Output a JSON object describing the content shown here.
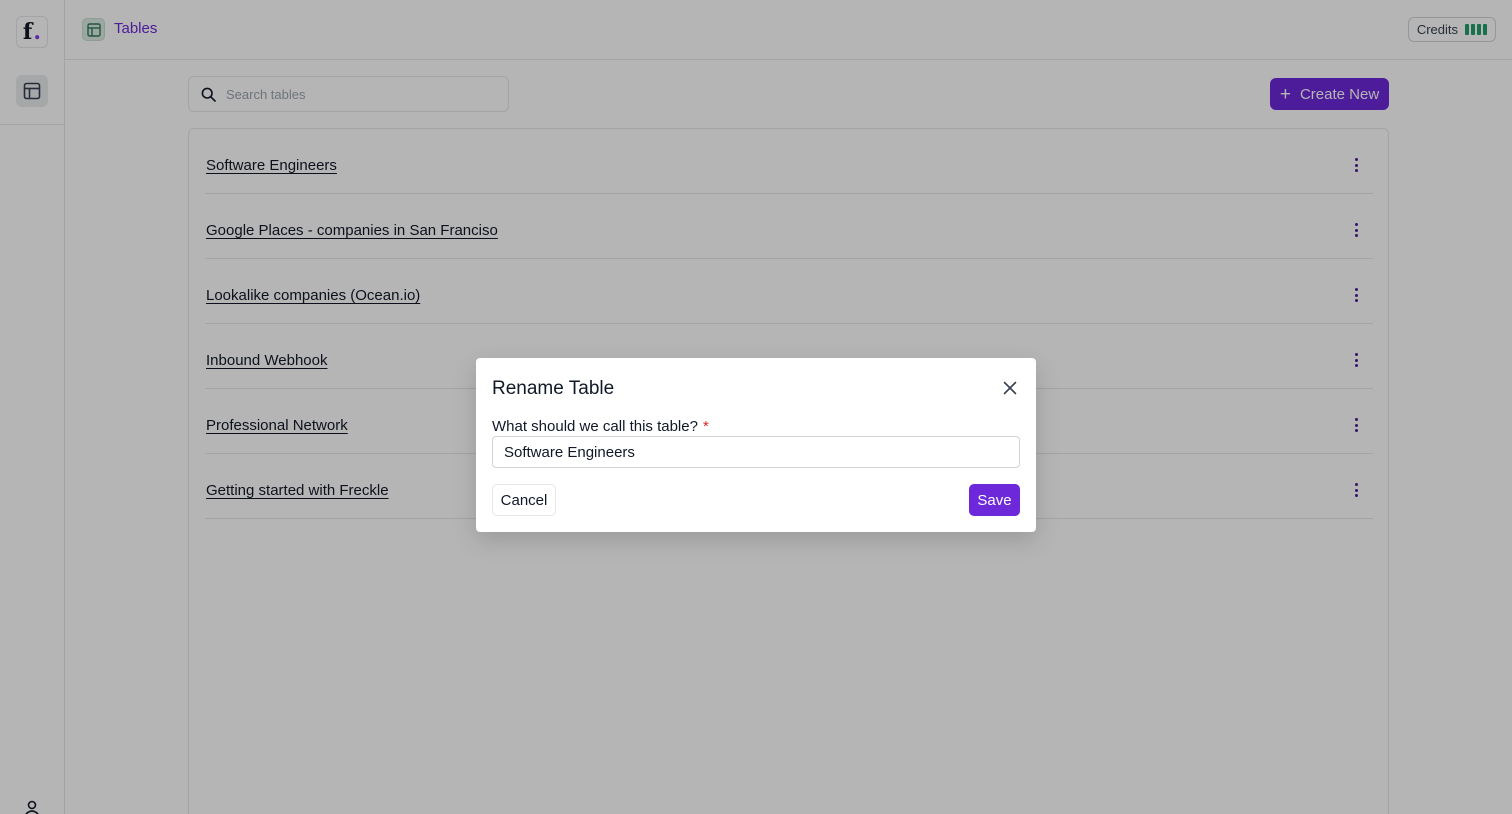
{
  "sidebar": {
    "logo_letter": "f",
    "logo_dot": ".",
    "nav_icon": "table-icon",
    "user_icon": "user-icon"
  },
  "header": {
    "icon": "table-icon",
    "title": "Tables",
    "credits_label": "Credits",
    "credits_bars": 4
  },
  "search": {
    "placeholder": "Search tables",
    "value": ""
  },
  "create_button": {
    "label": "Create New",
    "icon": "plus-icon"
  },
  "tables": [
    {
      "name": "Software Engineers"
    },
    {
      "name": "Google Places - companies in San Franciso"
    },
    {
      "name": "Lookalike companies (Ocean.io)"
    },
    {
      "name": "Inbound Webhook"
    },
    {
      "name": "Professional Network"
    },
    {
      "name": "Getting started with Freckle"
    }
  ],
  "modal": {
    "title": "Rename Table",
    "field_label": "What should we call this table?",
    "required_mark": "*",
    "field_value": "Software Engineers",
    "cancel_label": "Cancel",
    "save_label": "Save"
  },
  "colors": {
    "accent": "#6d28d9",
    "credits_green": "#22a06b",
    "required_red": "#dc2626"
  }
}
